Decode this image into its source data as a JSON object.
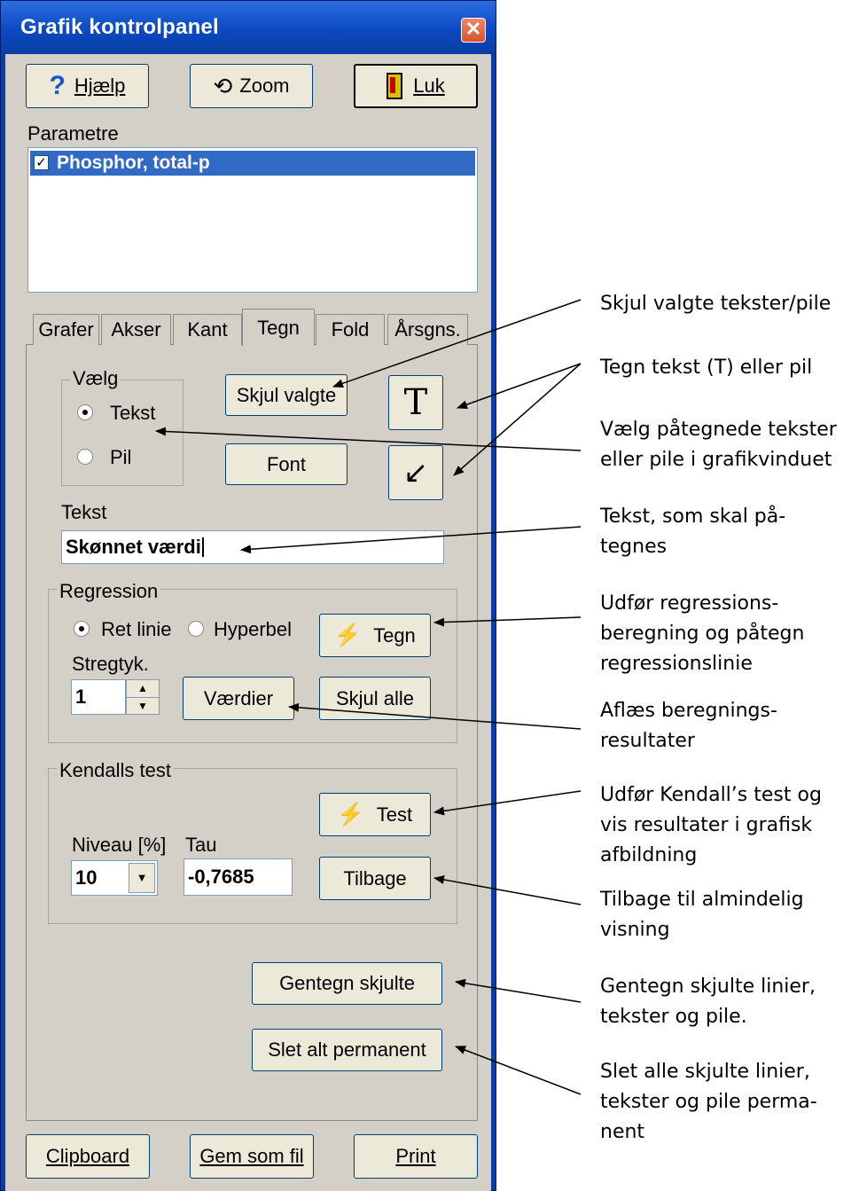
{
  "window": {
    "title": "Grafik kontrolpanel",
    "close_glyph": "✕"
  },
  "toolbar": {
    "help_label": "Hjælp",
    "help_icon": "question-icon",
    "zoom_label": "Zoom",
    "zoom_icon": "undo-arrow-icon",
    "close_label": "Luk",
    "close_icon": "door-icon"
  },
  "parameters": {
    "label": "Parametre",
    "items": [
      {
        "label": "Phosphor, total-p",
        "checked": true,
        "selected": true
      }
    ]
  },
  "tabs": [
    {
      "label": "Grafer"
    },
    {
      "label": "Akser"
    },
    {
      "label": "Kant"
    },
    {
      "label": "Tegn",
      "active": true
    },
    {
      "label": "Fold"
    },
    {
      "label": "Årsgns."
    }
  ],
  "vaelg": {
    "title": "Vælg",
    "options": [
      {
        "label": "Tekst",
        "checked": true
      },
      {
        "label": "Pil",
        "checked": false
      }
    ]
  },
  "draw": {
    "hide_selected_label": "Skjul valgte",
    "font_label": "Font",
    "text_tool_glyph": "T",
    "arrow_tool_glyph": "↙"
  },
  "text_field": {
    "label": "Tekst",
    "value": "Skønnet værdi"
  },
  "regression": {
    "title": "Regression",
    "options": [
      {
        "label": "Ret linie",
        "checked": true
      },
      {
        "label": "Hyperbel",
        "checked": false
      }
    ],
    "draw_label": "Tegn",
    "stroke_label": "Stregtyk.",
    "stroke_value": "1",
    "values_label": "Værdier",
    "hide_all_label": "Skjul alle"
  },
  "kendall": {
    "title": "Kendalls test",
    "test_label": "Test",
    "level_label": "Niveau [%]",
    "level_value": "10",
    "tau_label": "Tau",
    "tau_value": "-0,7685",
    "back_label": "Tilbage"
  },
  "actions": {
    "redraw_hidden_label": "Gentegn skjulte",
    "delete_permanent_label": "Slet alt permanent"
  },
  "bottom": {
    "clipboard_label": "Clipboard",
    "save_label": "Gem som fil",
    "print_label": "Print"
  },
  "annotations": [
    {
      "lines": [
        "Skjul valgte tekster/pile"
      ]
    },
    {
      "lines": [
        "Tegn tekst (T) eller pil"
      ]
    },
    {
      "lines": [
        "Vælg påtegnede tekster",
        "eller pile i grafikvinduet"
      ]
    },
    {
      "lines": [
        "Tekst, som skal på-",
        "tegnes"
      ]
    },
    {
      "lines": [
        "Udfør regressions-",
        "beregning og påtegn",
        "regressionslinie"
      ]
    },
    {
      "lines": [
        "Aflæs beregnings-",
        "resultater"
      ]
    },
    {
      "lines": [
        "Udfør Kendall’s test og",
        "vis resultater i grafisk",
        "afbildning"
      ]
    },
    {
      "lines": [
        "Tilbage til almindelig",
        "visning"
      ]
    },
    {
      "lines": [
        "Gentegn skjulte linier,",
        "tekster og pile."
      ]
    },
    {
      "lines": [
        "Slet alle skjulte linier,",
        "tekster og pile perma-",
        "nent"
      ]
    }
  ],
  "colors": {
    "title_bar": "#0a3ea3",
    "selection": "#316ac5",
    "face": "#d4d0c8",
    "button": "#ece9d8",
    "lightning": "#ffd400"
  }
}
